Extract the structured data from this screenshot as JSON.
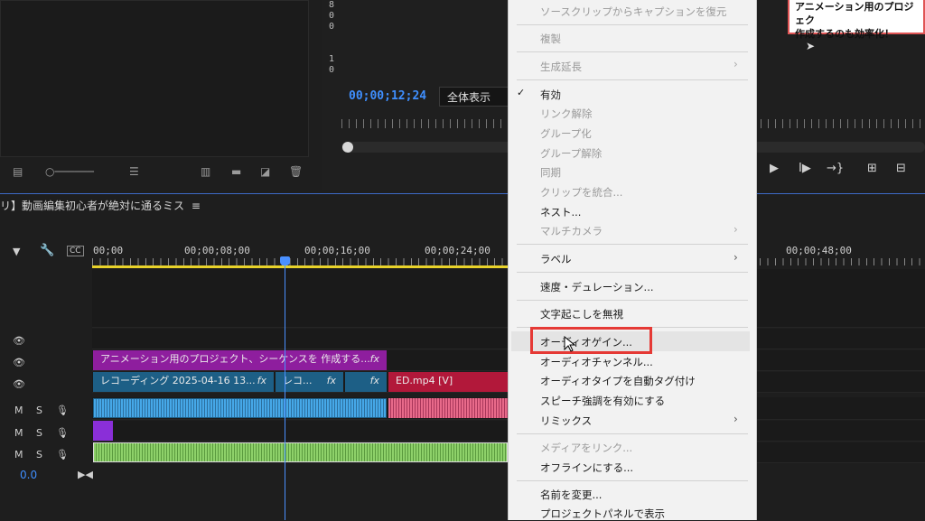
{
  "program": {
    "ruler_top": [
      "8",
      "0",
      "0"
    ],
    "ruler_bottom": [
      "1",
      "0"
    ],
    "timecode": "00;00;12;24",
    "fit": "全体表示"
  },
  "tooltip": {
    "line1": "アニメーション用のプロジェク",
    "line2": "作成するのも効率化！"
  },
  "timeline": {
    "sequence_title": "リ】動画編集初心者が絶対に通るミス",
    "menu_glyph": "≡",
    "ruler": [
      "00;00",
      "00;00;08;00",
      "00;00;16;00",
      "00;00;24;00",
      "00;00;48;00"
    ],
    "audio_level": "0.0",
    "tracks": {
      "m": "M",
      "s": "S"
    },
    "clips": {
      "v3_title": "アニメーション用のプロジェクト、シーケンスを 作成する...",
      "v2_a": "レコーディング 2025-04-16 13...",
      "v2_b": "レコ...",
      "v2_end": "ED.mp4 [V]",
      "fx": "fx"
    }
  },
  "context_menu": {
    "items": [
      {
        "label": "ソースクリップからキャプションを復元",
        "enabled": false
      },
      {
        "label": "複製",
        "enabled": false
      },
      {
        "label": "生成延長",
        "enabled": false,
        "submenu": true
      },
      {
        "label": "有効",
        "enabled": true,
        "checked": true
      },
      {
        "label": "リンク解除",
        "enabled": false
      },
      {
        "label": "グループ化",
        "enabled": false
      },
      {
        "label": "グループ解除",
        "enabled": false
      },
      {
        "label": "同期",
        "enabled": false
      },
      {
        "label": "クリップを統合...",
        "enabled": false
      },
      {
        "label": "ネスト...",
        "enabled": true
      },
      {
        "label": "マルチカメラ",
        "enabled": false,
        "submenu": true
      },
      {
        "label": "ラベル",
        "enabled": true,
        "submenu": true
      },
      {
        "label": "速度・デュレーション...",
        "enabled": true
      },
      {
        "label": "文字起こしを無視",
        "enabled": true
      },
      {
        "label": "オーディオゲイン...",
        "enabled": true,
        "highlighted": true
      },
      {
        "label": "オーディオチャンネル...",
        "enabled": true
      },
      {
        "label": "オーディオタイプを自動タグ付け",
        "enabled": true
      },
      {
        "label": "スピーチ強調を有効にする",
        "enabled": true
      },
      {
        "label": "リミックス",
        "enabled": true,
        "submenu": true
      },
      {
        "label": "メディアをリンク...",
        "enabled": false
      },
      {
        "label": "オフラインにする...",
        "enabled": true
      },
      {
        "label": "名前を変更...",
        "enabled": true
      },
      {
        "label": "プロジェクトパネルで表示",
        "enabled": true
      }
    ],
    "check_glyph": "✓",
    "submenu_glyph": "›"
  },
  "colors": {
    "accent_blue": "#3f8fff",
    "highlight_red": "#e53935",
    "clip_purple": "#8e1e9e",
    "clip_teal": "#1d5f86",
    "clip_red": "#b2183a",
    "audio_blue": "#46a8e8",
    "audio_pink": "#e86a8a",
    "audio_green": "#8ed16a"
  },
  "icons": [
    "list-view-icon",
    "zoom-slider-icon",
    "sort-icon",
    "automate-icon",
    "new-bin-icon",
    "new-item-icon",
    "trash-icon",
    "play-icon",
    "step-forward-icon",
    "go-to-out-icon",
    "lift-icon",
    "extract-icon",
    "eye-icon",
    "mic-icon",
    "marker-icon",
    "wrench-icon",
    "captions-icon"
  ]
}
